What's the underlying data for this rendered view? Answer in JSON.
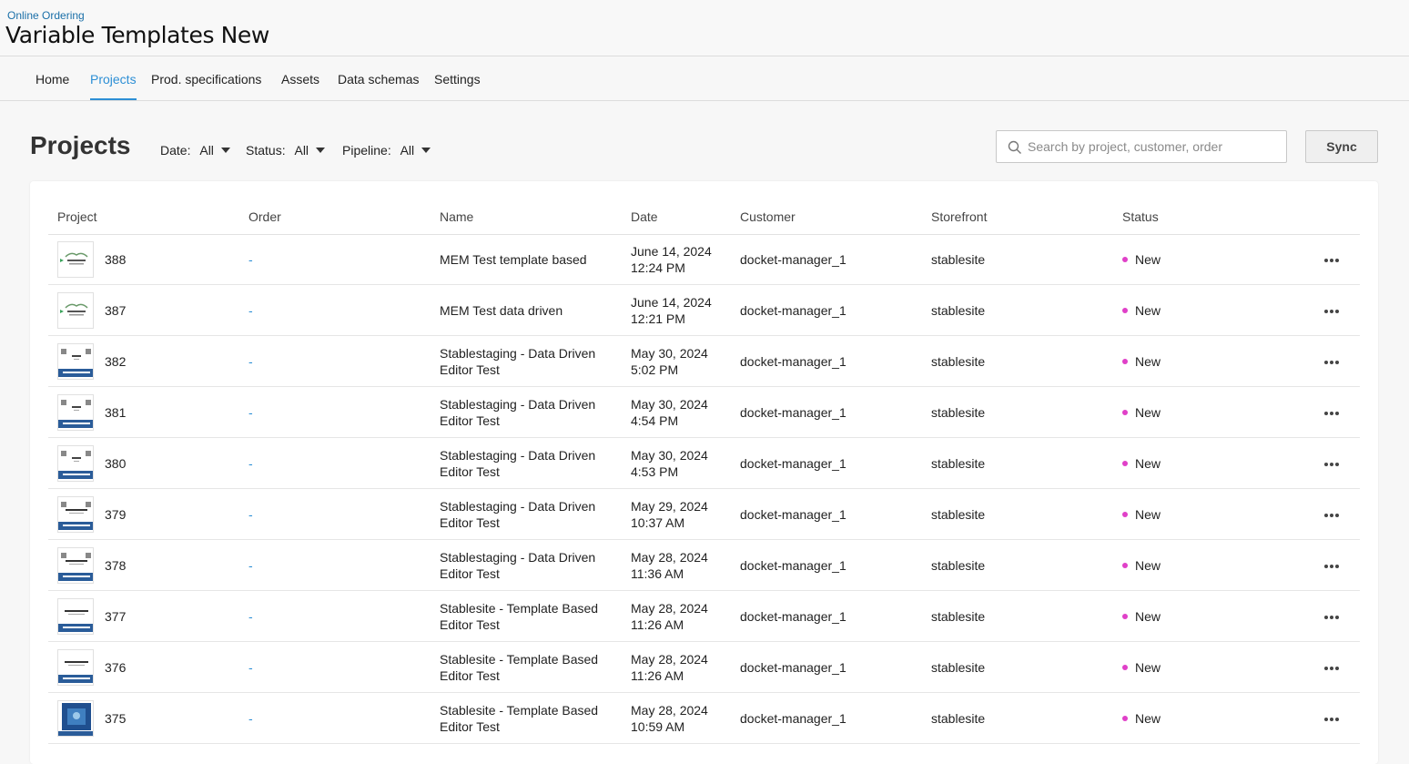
{
  "header": {
    "breadcrumb": "Online Ordering",
    "title": "Variable Templates New"
  },
  "nav": {
    "tabs": [
      {
        "label": "Home"
      },
      {
        "label": "Projects",
        "active": true
      },
      {
        "label": "Prod. specifications"
      },
      {
        "label": "Assets"
      },
      {
        "label": "Data schemas"
      },
      {
        "label": "Settings"
      }
    ]
  },
  "toolbar": {
    "page_title": "Projects",
    "filters": [
      {
        "label": "Date:",
        "value": "All"
      },
      {
        "label": "Status:",
        "value": "All"
      },
      {
        "label": "Pipeline:",
        "value": "All"
      }
    ],
    "search_placeholder": "Search by project, customer, order",
    "sync_label": "Sync"
  },
  "table": {
    "columns": [
      "Project",
      "Order",
      "Name",
      "Date",
      "Customer",
      "Storefront",
      "Status"
    ],
    "rows": [
      {
        "thumb": "logo-template",
        "project": "388",
        "order": "-",
        "name1": "MEM Test template based",
        "name2": "",
        "date1": "June 14, 2024",
        "date2": "12:24 PM",
        "customer": "docket-manager_1",
        "storefront": "stablesite",
        "status": "New"
      },
      {
        "thumb": "logo-template",
        "project": "387",
        "order": "-",
        "name1": "MEM Test data driven",
        "name2": "",
        "date1": "June 14, 2024",
        "date2": "12:21 PM",
        "customer": "docket-manager_1",
        "storefront": "stablesite",
        "status": "New"
      },
      {
        "thumb": "business-card-blue",
        "project": "382",
        "order": "-",
        "name1": "Stablestaging - Data Driven",
        "name2": "Editor Test",
        "date1": "May 30, 2024",
        "date2": "5:02 PM",
        "customer": "docket-manager_1",
        "storefront": "stablesite",
        "status": "New"
      },
      {
        "thumb": "business-card-blue",
        "project": "381",
        "order": "-",
        "name1": "Stablestaging - Data Driven",
        "name2": "Editor Test",
        "date1": "May 30, 2024",
        "date2": "4:54 PM",
        "customer": "docket-manager_1",
        "storefront": "stablesite",
        "status": "New"
      },
      {
        "thumb": "business-card-blue",
        "project": "380",
        "order": "-",
        "name1": "Stablestaging - Data Driven",
        "name2": "Editor Test",
        "date1": "May 30, 2024",
        "date2": "4:53 PM",
        "customer": "docket-manager_1",
        "storefront": "stablesite",
        "status": "New"
      },
      {
        "thumb": "business-card-company",
        "project": "379",
        "order": "-",
        "name1": "Stablestaging - Data Driven",
        "name2": "Editor Test",
        "date1": "May 29, 2024",
        "date2": "10:37 AM",
        "customer": "docket-manager_1",
        "storefront": "stablesite",
        "status": "New"
      },
      {
        "thumb": "business-card-company",
        "project": "378",
        "order": "-",
        "name1": "Stablestaging - Data Driven",
        "name2": "Editor Test",
        "date1": "May 28, 2024",
        "date2": "11:36 AM",
        "customer": "docket-manager_1",
        "storefront": "stablesite",
        "status": "New"
      },
      {
        "thumb": "business-card-plain",
        "project": "377",
        "order": "-",
        "name1": "Stablesite - Template Based",
        "name2": "Editor Test",
        "date1": "May 28, 2024",
        "date2": "11:26 AM",
        "customer": "docket-manager_1",
        "storefront": "stablesite",
        "status": "New"
      },
      {
        "thumb": "business-card-plain",
        "project": "376",
        "order": "-",
        "name1": "Stablesite - Template Based",
        "name2": "Editor Test",
        "date1": "May 28, 2024",
        "date2": "11:26 AM",
        "customer": "docket-manager_1",
        "storefront": "stablesite",
        "status": "New"
      },
      {
        "thumb": "photo-card",
        "project": "375",
        "order": "-",
        "name1": "Stablesite - Template Based",
        "name2": "Editor Test",
        "date1": "May 28, 2024",
        "date2": "10:59 AM",
        "customer": "docket-manager_1",
        "storefront": "stablesite",
        "status": "New"
      }
    ]
  },
  "colors": {
    "accent": "#2d8fd5",
    "status_new": "#e040c8",
    "breadcrumb": "#1a6fa8"
  }
}
